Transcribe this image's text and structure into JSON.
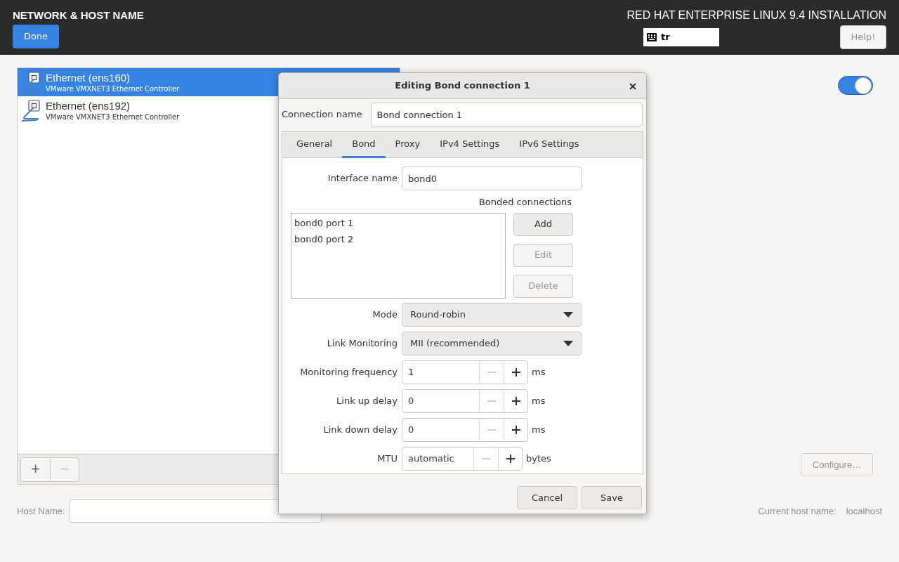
{
  "header": {
    "title": "NETWORK & HOST NAME",
    "done_button": "Done",
    "product": "RED HAT ENTERPRISE LINUX 9.4 INSTALLATION",
    "keyboard_layout": "tr",
    "help_button": {
      "label": "Help!",
      "disabled": true
    }
  },
  "devices": [
    {
      "name": "Ethernet (ens160)",
      "description": "VMware VMXNET3 Ethernet Controller",
      "selected": true
    },
    {
      "name": "Ethernet (ens192)",
      "description": "VMware VMXNET3 Ethernet Controller",
      "selected": false
    }
  ],
  "device_toolbar": [
    {
      "label": "+",
      "disabled": false
    },
    {
      "label": "−",
      "disabled": true
    }
  ],
  "device_switch": {
    "on": true
  },
  "configure_button": {
    "label": "Configure…",
    "disabled": true
  },
  "host_name": {
    "label": "Host Name:"
  },
  "current_host_name": {
    "label": "Current host name:",
    "value": "localhost"
  },
  "dialog": {
    "title": "Editing Bond connection 1",
    "connection_name": {
      "label": "Connection name",
      "value": "Bond connection 1"
    },
    "tabs": [
      {
        "label": "General",
        "selected": false
      },
      {
        "label": "Bond",
        "selected": true
      },
      {
        "label": "Proxy",
        "selected": false
      },
      {
        "label": "IPv4 Settings",
        "selected": false
      },
      {
        "label": "IPv6 Settings",
        "selected": false
      }
    ],
    "interface_name": {
      "label": "Interface name",
      "value": "bond0"
    },
    "bonded_connections": {
      "label": "Bonded connections",
      "items": [
        "bond0 port 1",
        "bond0 port 2"
      ],
      "buttons": [
        {
          "label": "Add",
          "disabled": false
        },
        {
          "label": "Edit",
          "disabled": true
        },
        {
          "label": "Delete",
          "disabled": true
        }
      ]
    },
    "dropdowns": [
      {
        "label": "Mode",
        "value": "Round-robin"
      },
      {
        "label": "Link Monitoring",
        "value": "MII (recommended)"
      }
    ],
    "spin_rows": [
      {
        "label": "Monitoring frequency",
        "value": "1",
        "unit": "ms",
        "decrement_disabled": true
      },
      {
        "label": "Link up delay",
        "value": "0",
        "unit": "ms",
        "decrement_disabled": true
      },
      {
        "label": "Link down delay",
        "value": "0",
        "unit": "ms",
        "decrement_disabled": true
      },
      {
        "label": "MTU",
        "value": "automatic",
        "unit": "bytes",
        "decrement_disabled": true
      }
    ],
    "buttons": [
      "Cancel",
      "Save"
    ]
  }
}
